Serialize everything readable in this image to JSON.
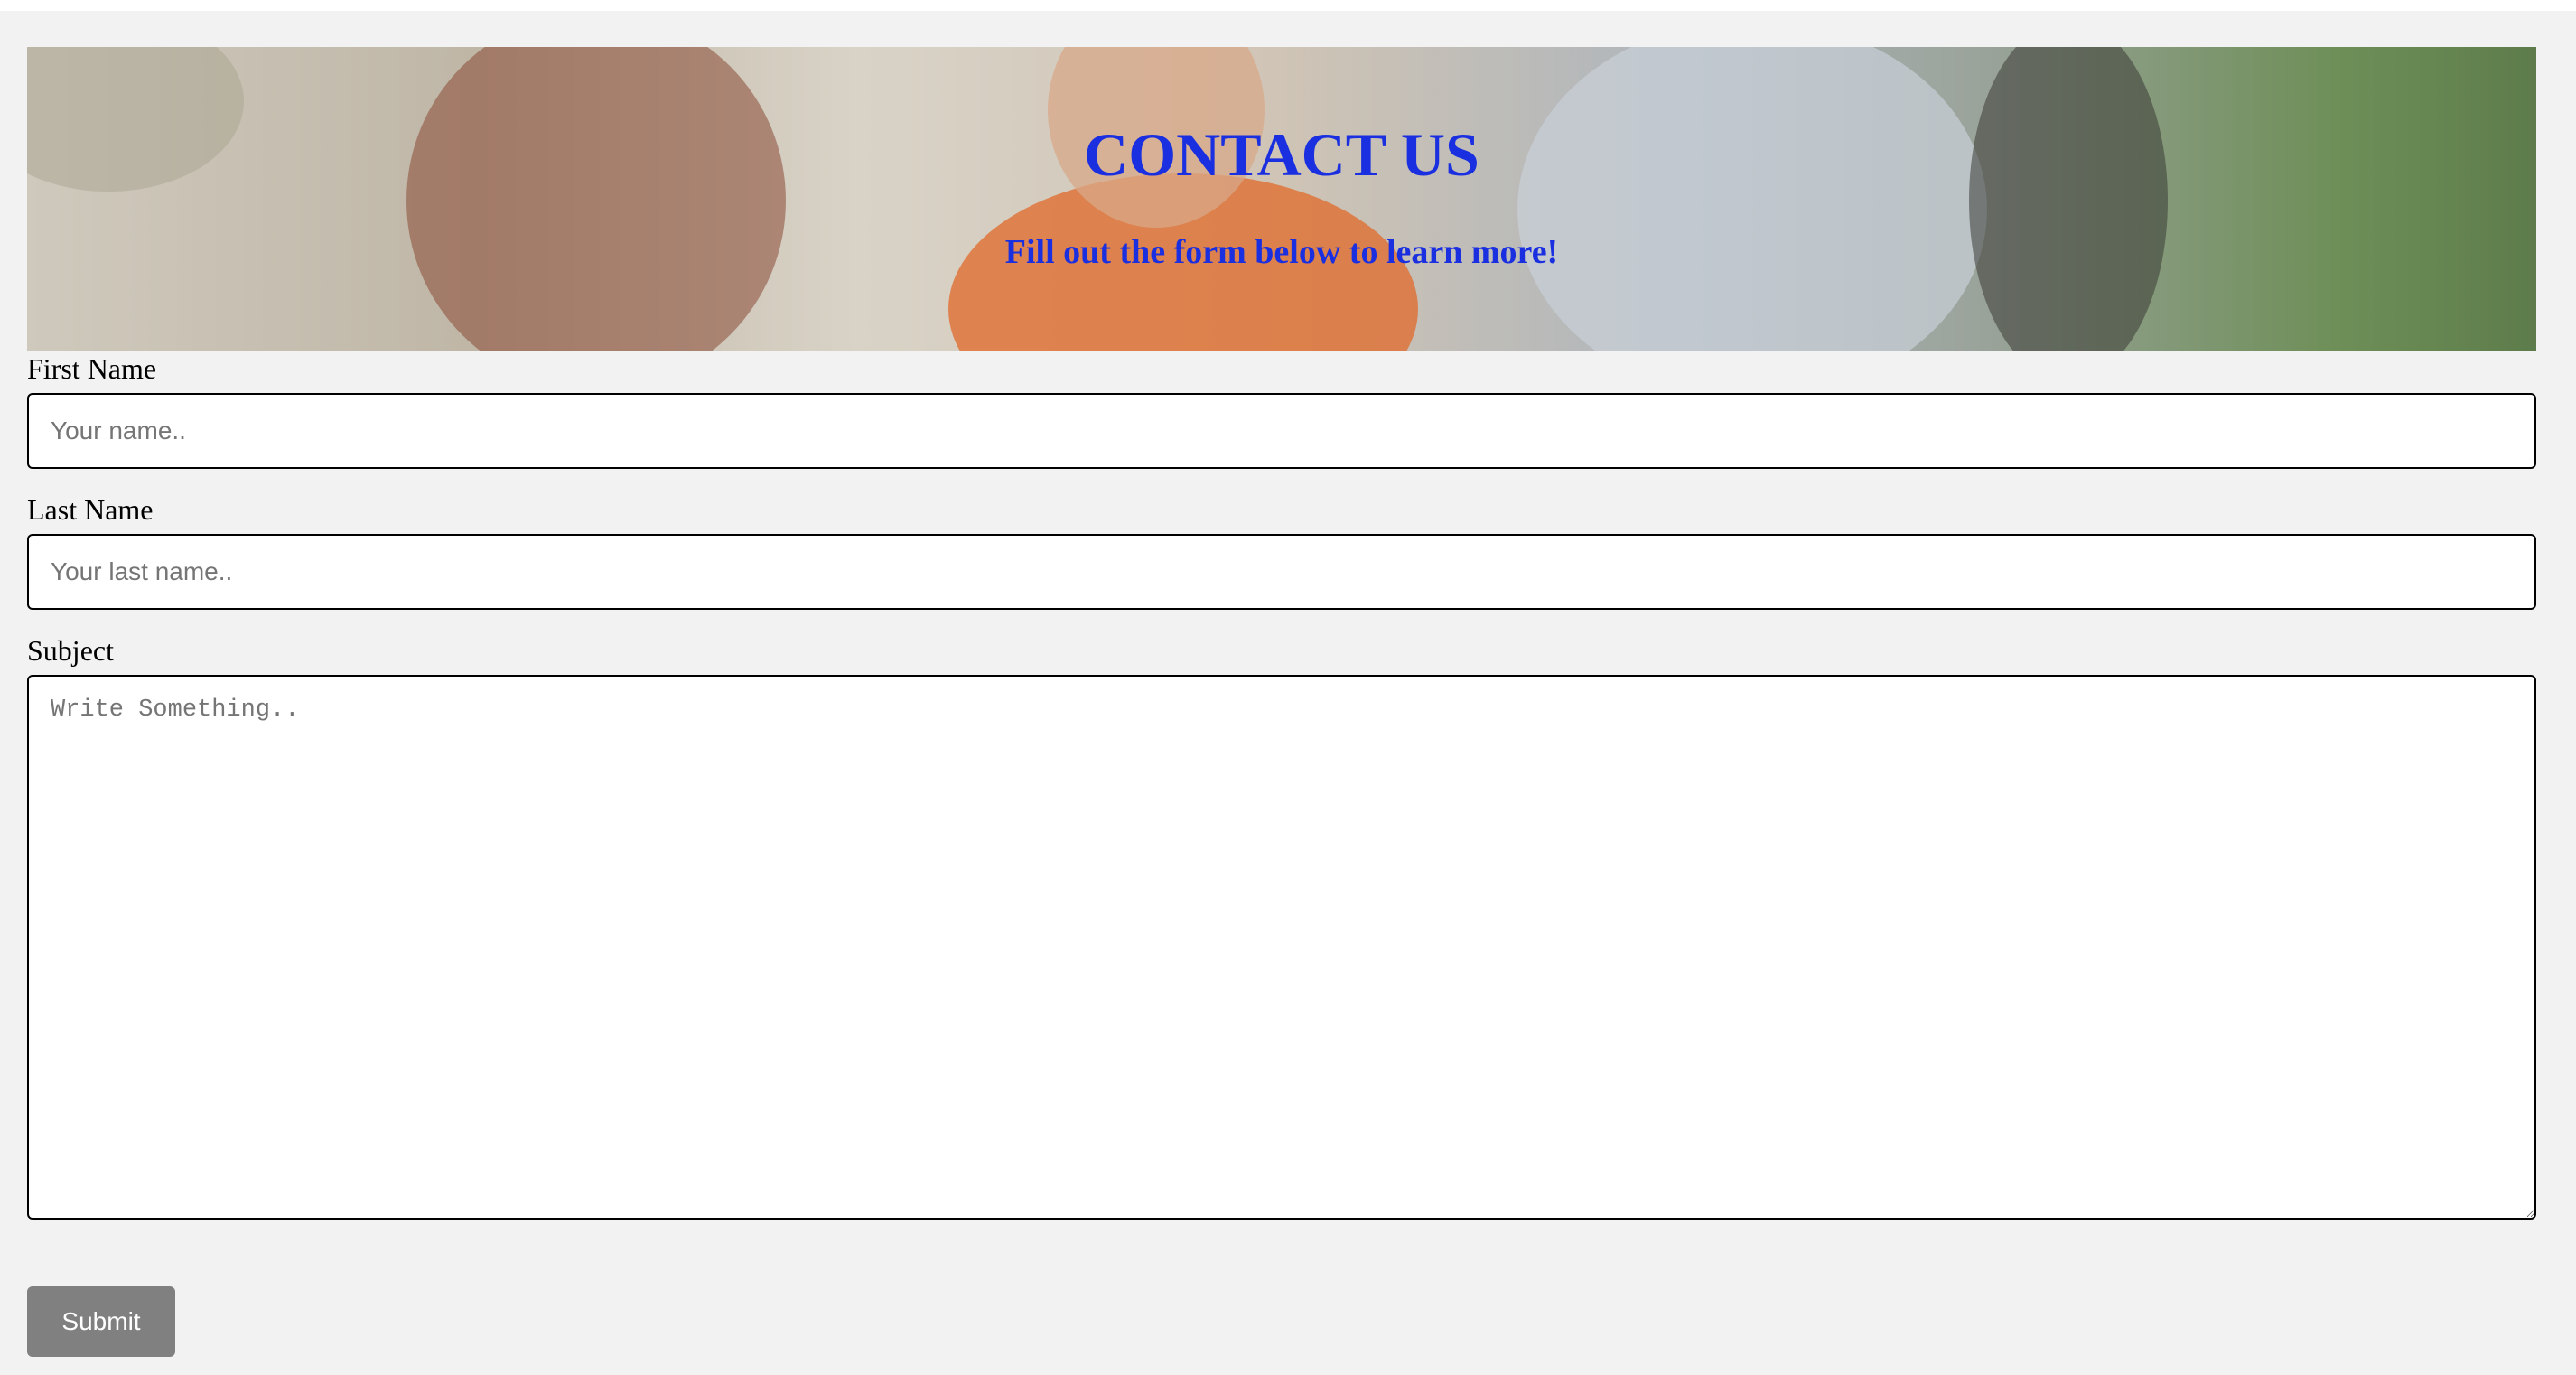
{
  "hero": {
    "title": "CONTACT US",
    "subtitle": "Fill out the form below to learn more!",
    "title_color": "#1a2fe0"
  },
  "form": {
    "first_name": {
      "label": "First Name",
      "placeholder": "Your name.."
    },
    "last_name": {
      "label": "Last Name",
      "placeholder": "Your last name.."
    },
    "subject": {
      "label": "Subject",
      "placeholder": "Write Something.."
    },
    "submit_label": "Submit",
    "submit_color": "#808080"
  }
}
